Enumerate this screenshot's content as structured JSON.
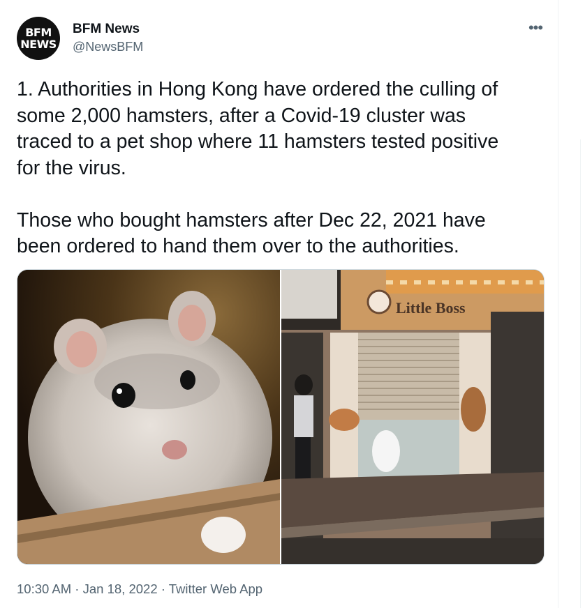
{
  "author": {
    "name": "BFM News",
    "handle": "@NewsBFM",
    "avatar_lines": [
      "BFM",
      "NEWS"
    ]
  },
  "more_icon": "•••",
  "tweet": {
    "text": "1. Authorities in Hong Kong have ordered the culling of\nsome 2,000 hamsters, after a Covid-19 cluster was\ntraced to a pet shop where 11 hamsters tested positive\nfor the virus.\n\nThose who bought hamsters after Dec 22, 2021 have\nbeen ordered to hand them over to the authorities."
  },
  "media": {
    "images": [
      {
        "name": "hamster-photo"
      },
      {
        "name": "pet-shop-photo",
        "shop_sign": "Little Boss"
      }
    ]
  },
  "meta": {
    "time": "10:30 AM",
    "sep1": " · ",
    "date": "Jan 18, 2022",
    "sep2": " · ",
    "source": "Twitter Web App"
  },
  "colors": {
    "text": "#0f1419",
    "secondary": "#536471",
    "border": "#cfd9de",
    "avatar_bg": "#111111"
  }
}
